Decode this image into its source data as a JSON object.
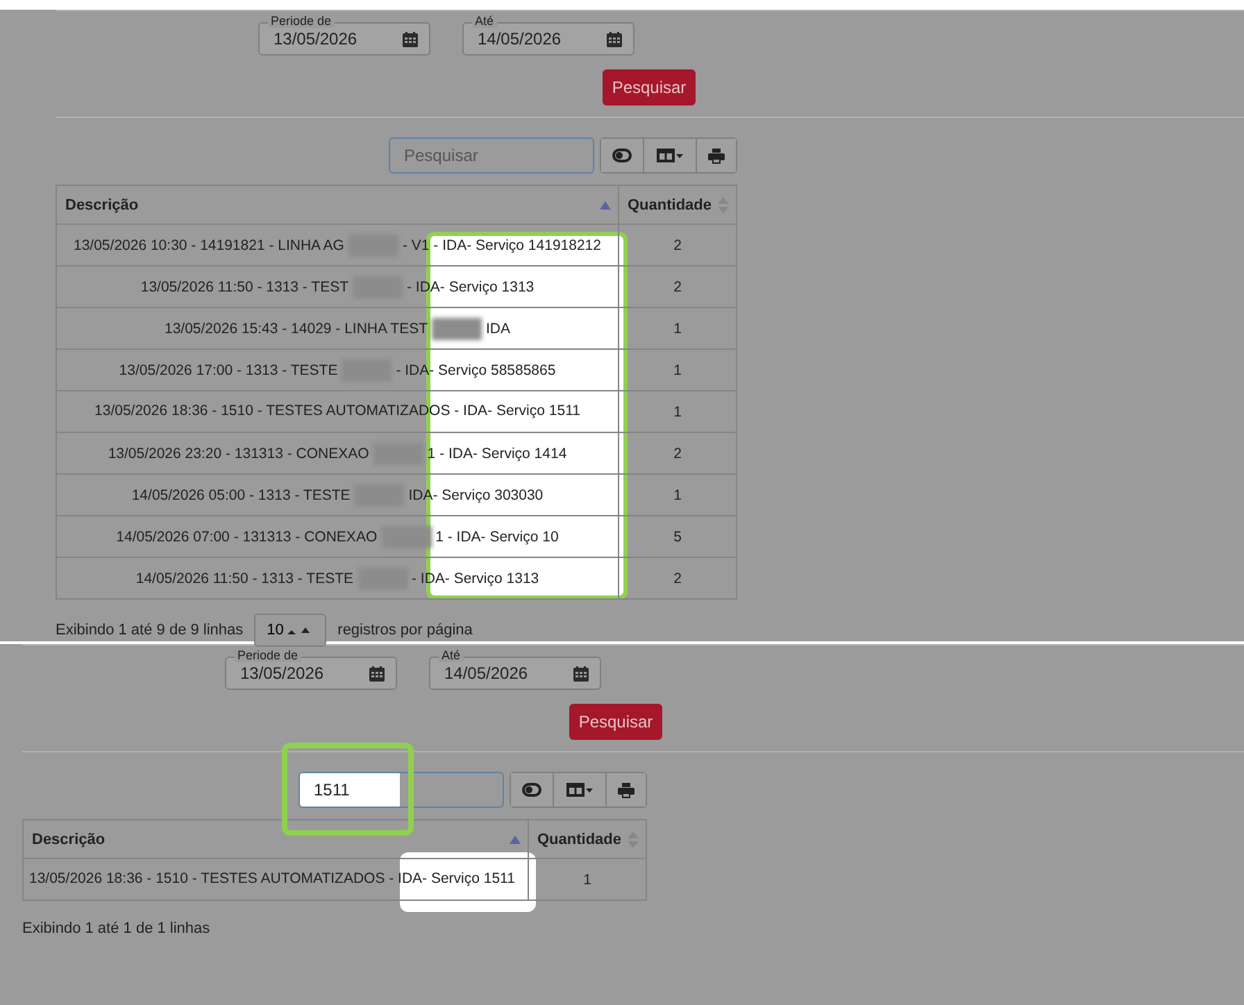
{
  "panels": [
    {
      "column_highlighted": true,
      "period_from": {
        "label": "Periode de",
        "value": "13/05/2026"
      },
      "period_to": {
        "label": "Até",
        "value": "14/05/2026"
      },
      "search_button": "Pesquisar",
      "search": {
        "placeholder": "Pesquisar"
      },
      "table": {
        "columns": [
          {
            "label": "Descrição",
            "sorted": true
          },
          {
            "label": "Quantidade",
            "sorted": false
          }
        ],
        "centered": true,
        "rows": [
          {
            "description": [
              "13/05/2026 10:30 - 14191821 - LINHA AG",
              "- V1 - IDA- Serviço 141918212"
            ],
            "quantity": "2"
          },
          {
            "description": [
              "13/05/2026 11:50 - 1313 - TEST",
              "- IDA- Serviço 1313"
            ],
            "quantity": "2"
          },
          {
            "description": [
              "13/05/2026 15:43 - 14029 - LINHA TEST",
              "IDA"
            ],
            "quantity": "1"
          },
          {
            "description": [
              "13/05/2026 17:00 - 1313 - TESTE",
              "- IDA- Serviço 58585865"
            ],
            "quantity": "1"
          },
          {
            "description": [
              "13/05/2026 18:36 - 1510 - TESTES AUTOMATIZADOS - IDA- Serviço 1511"
            ],
            "quantity": "1"
          },
          {
            "description": [
              "13/05/2026 23:20 - 131313 - CONEXAO",
              "1 - IDA- Serviço 1414"
            ],
            "quantity": "2"
          },
          {
            "description": [
              "14/05/2026 05:00 - 1313 - TESTE",
              "IDA- Serviço 303030"
            ],
            "quantity": "1"
          },
          {
            "description": [
              "14/05/2026 07:00 - 131313 - CONEXAO",
              "1 - IDA- Serviço 10"
            ],
            "quantity": "5"
          },
          {
            "description": [
              "14/05/2026 11:50 - 1313 - TESTE",
              "- IDA- Serviço 1313"
            ],
            "quantity": "2"
          }
        ]
      },
      "footer": {
        "summary": "Exibindo 1 até 9 de 9 linhas",
        "page_size": "10",
        "page_size_suffix": "registros por página"
      }
    },
    {
      "search_highlighted": true,
      "result_highlighted": true,
      "period_from": {
        "label": "Periode de",
        "value": "13/05/2026"
      },
      "period_to": {
        "label": "Até",
        "value": "14/05/2026"
      },
      "search_button": "Pesquisar",
      "search": {
        "value": "1511"
      },
      "table": {
        "columns": [
          {
            "label": "Descrição",
            "sorted": true
          },
          {
            "label": "Quantidade",
            "sorted": false
          }
        ],
        "centered": false,
        "rows": [
          {
            "description": [
              "13/05/2026 18:36 - 1510 - TESTES AUTOMATIZADOS - IDA- Serviço 1511"
            ],
            "quantity": "1"
          }
        ]
      },
      "footer": {
        "summary": "Exibindo 1 até 1 de 1 linhas"
      }
    }
  ]
}
